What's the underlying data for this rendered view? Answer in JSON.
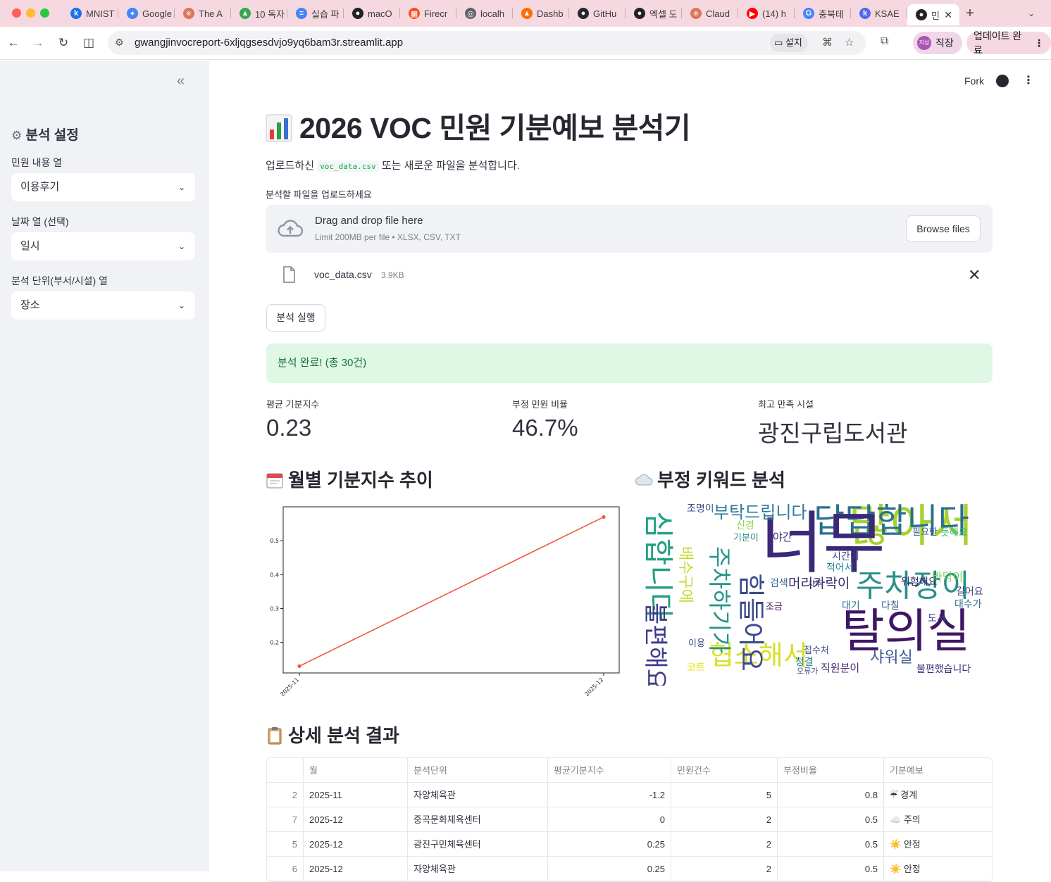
{
  "browser": {
    "tabs": [
      {
        "label": "MNIST",
        "icon": "k-icon",
        "color": "#1a73e8"
      },
      {
        "label": "Google",
        "icon": "gemini-icon",
        "color": "#4285f4"
      },
      {
        "label": "The A",
        "icon": "claude-icon",
        "color": "#d97757"
      },
      {
        "label": "10 독자",
        "icon": "drive-icon",
        "color": "#34a853"
      },
      {
        "label": "실습 파",
        "icon": "docs-icon",
        "color": "#4285f4"
      },
      {
        "label": "macO",
        "icon": "app-icon",
        "color": "#222222"
      },
      {
        "label": "Firecr",
        "icon": "firecrawl-icon",
        "color": "#f4511e"
      },
      {
        "label": "localh",
        "icon": "globe-icon",
        "color": "#5f6368"
      },
      {
        "label": "Dashb",
        "icon": "flame-icon",
        "color": "#ff6d00"
      },
      {
        "label": "GitHu",
        "icon": "github-icon",
        "color": "#24292f"
      },
      {
        "label": "엑셀 도",
        "icon": "app-icon",
        "color": "#222222"
      },
      {
        "label": "Claud",
        "icon": "claude-icon",
        "color": "#d97757"
      },
      {
        "label": "(14) h",
        "icon": "youtube-icon",
        "color": "#ff0000"
      },
      {
        "label": "충북테",
        "icon": "google-icon",
        "color": "#4285f4"
      },
      {
        "label": "KSAE",
        "icon": "k-icon",
        "color": "#4f6bed"
      }
    ],
    "active_tab": {
      "label": "민",
      "icon": "streamlit-icon"
    },
    "url": "gwangjinvocreport-6xljqgsesdvjo9yq6bam3r.streamlit.app",
    "install_label": "설치",
    "profile_label": "직장",
    "profile_pic_text": "지성",
    "update_label": "업데이트 완료"
  },
  "sidebar": {
    "title": "분석 설정",
    "fields": [
      {
        "label": "민원 내용 열",
        "value": "이용후기"
      },
      {
        "label": "날짜 열 (선택)",
        "value": "일시"
      },
      {
        "label": "분석 단위(부서/시설) 열",
        "value": "장소"
      }
    ]
  },
  "header": {
    "fork_label": "Fork"
  },
  "main": {
    "title": "2026 VOC 민원 기분예보 분석기",
    "intro_prefix": "업로드하신",
    "intro_code": "voc_data.csv",
    "intro_suffix": "또는 새로운 파일을 분석합니다.",
    "upload_label": "분석할 파일을 업로드하세요",
    "dropzone_main": "Drag and drop file here",
    "dropzone_sub": "Limit 200MB per file • XLSX, CSV, TXT",
    "browse_label": "Browse files",
    "file_name": "voc_data.csv",
    "file_size": "3.9KB",
    "run_label": "분석 실행",
    "success_message": "분석 완료! (총 30건)",
    "metrics": [
      {
        "label": "평균 기분지수",
        "value": "0.23"
      },
      {
        "label": "부정 민원 비율",
        "value": "46.7%"
      },
      {
        "label": "최고 만족 시설",
        "value": "광진구립도서관"
      }
    ],
    "trend_title": "월별 기분지수 추이",
    "keyword_title": "부정 키워드 분석",
    "detail_title": "상세 분석 결과"
  },
  "chart_data": {
    "type": "line",
    "x": [
      "2025-11",
      "2025-12"
    ],
    "series": [
      {
        "values": [
          0.13,
          0.57
        ],
        "color": "#ee5a3e"
      }
    ],
    "yticks": [
      0.2,
      0.3,
      0.4,
      0.5
    ],
    "ylim": [
      0.11,
      0.6
    ],
    "grid": false,
    "title": "",
    "xlabel": "",
    "ylabel": ""
  },
  "wordcloud": [
    {
      "w": "많아서",
      "c": "#a6d22e"
    },
    {
      "w": "탈의실",
      "c": "#3f1764"
    },
    {
      "w": "답답합니다",
      "c": "#2a6f8e"
    },
    {
      "w": "너무",
      "c": "#3b2876"
    },
    {
      "w": "주차장이",
      "c": "#2b8f8a"
    },
    {
      "w": "협소해서",
      "c": "#d9e02b"
    },
    {
      "w": "힘들어요",
      "c": "#3c4a8c"
    },
    {
      "w": "부탁드립니다",
      "c": "#2c7a9a"
    },
    {
      "w": "주차하기가",
      "c": "#23968a"
    },
    {
      "w": "심합니다",
      "c": "#21a082"
    },
    {
      "w": "불편해요",
      "c": "#3e3a88"
    },
    {
      "w": "배수구에",
      "c": "#c7d82f"
    },
    {
      "w": "머리카락이",
      "c": "#3a2d6e"
    },
    {
      "w": "샤워실",
      "c": "#3e5a92"
    },
    {
      "w": "직원분이",
      "c": "#4c2a77"
    },
    {
      "w": "불편했습니다",
      "c": "#3a2f7a"
    },
    {
      "w": "위험해요",
      "c": "#3a2570"
    },
    {
      "w": "바닥이",
      "c": "#7acf53"
    },
    {
      "w": "길어요",
      "c": "#3e4a8a"
    },
    {
      "w": "대수가",
      "c": "#2d6e8e"
    },
    {
      "w": "시간이",
      "c": "#3e3d86"
    },
    {
      "w": "적어서",
      "c": "#26828e"
    },
    {
      "w": "조명이",
      "c": "#3b4f8b"
    },
    {
      "w": "기분이",
      "c": "#2f8c8c"
    },
    {
      "w": "야간",
      "c": "#3e2f7a"
    },
    {
      "w": "대기",
      "c": "#2d7390"
    },
    {
      "w": "다칠",
      "c": "#33638d"
    },
    {
      "w": "도서",
      "c": "#3e4c8a"
    },
    {
      "w": "코트",
      "c": "#e4e41e"
    },
    {
      "w": "이용",
      "c": "#3b528b"
    },
    {
      "w": "청결",
      "c": "#2a788e"
    },
    {
      "w": "접수처",
      "c": "#404788"
    },
    {
      "w": "조금",
      "c": "#440154"
    },
    {
      "w": "검색",
      "c": "#31688e"
    },
    {
      "w": "필요한",
      "c": "#3b5c8b"
    },
    {
      "w": "듯해요",
      "c": "#35b779"
    },
    {
      "w": "오류가",
      "c": "#3d4e8a"
    },
    {
      "w": "신경",
      "c": "#8fd744"
    },
    {
      "w": "자주",
      "c": "#482475"
    }
  ],
  "table": {
    "columns": [
      "",
      "월",
      "분석단위",
      "평균기분지수",
      "민원건수",
      "부정비율",
      "기분예보"
    ],
    "rows": [
      {
        "idx": "2",
        "month": "2025-11",
        "unit": "자양체육관",
        "score": "-1.2",
        "count": "5",
        "neg": "0.8",
        "icon": "☔",
        "forecast": "경계"
      },
      {
        "idx": "7",
        "month": "2025-12",
        "unit": "중곡문화체육센터",
        "score": "0",
        "count": "2",
        "neg": "0.5",
        "icon": "☁️",
        "forecast": "주의"
      },
      {
        "idx": "5",
        "month": "2025-12",
        "unit": "광진구민체육센터",
        "score": "0.25",
        "count": "2",
        "neg": "0.5",
        "icon": "☀️",
        "forecast": "안정"
      },
      {
        "idx": "6",
        "month": "2025-12",
        "unit": "자양체육관",
        "score": "0.25",
        "count": "2",
        "neg": "0.5",
        "icon": "☀️",
        "forecast": "안정"
      }
    ]
  }
}
